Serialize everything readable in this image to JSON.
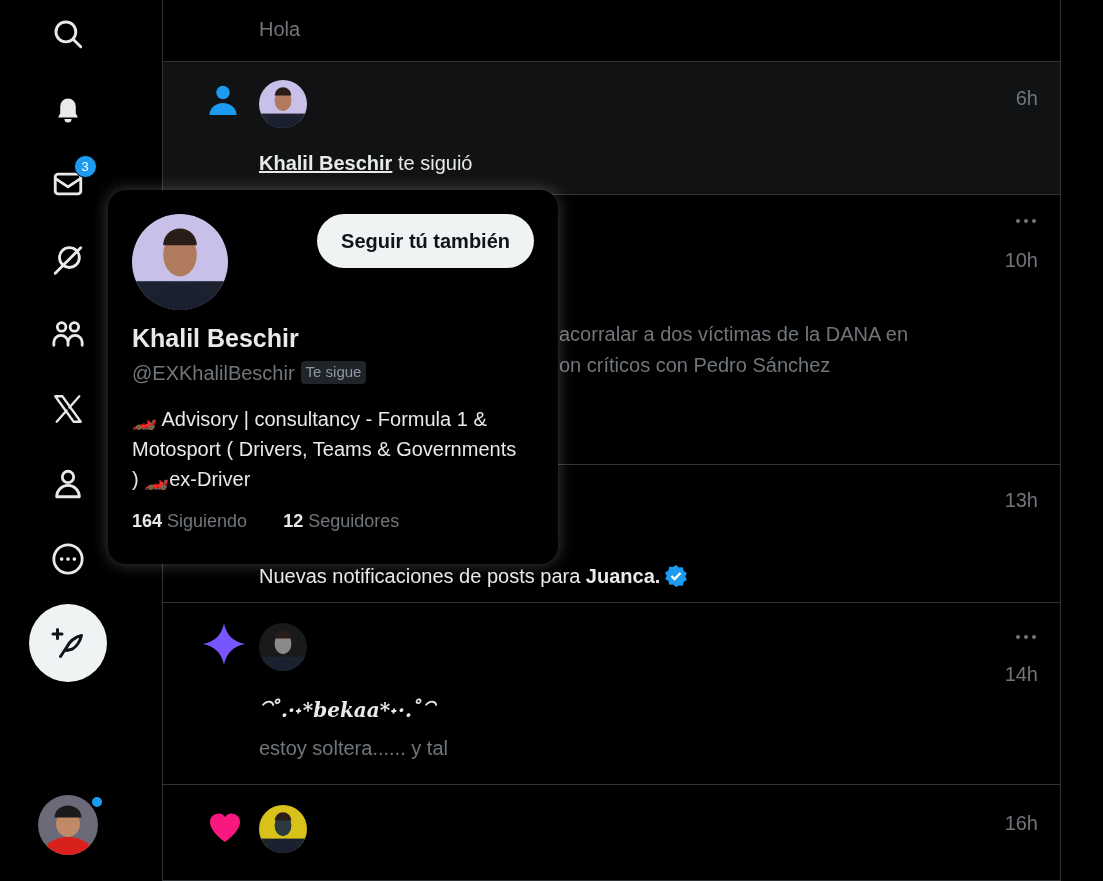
{
  "sidebar": {
    "items": [
      {
        "kind": "search"
      },
      {
        "kind": "bell"
      },
      {
        "kind": "mail",
        "badge": "3"
      },
      {
        "kind": "slash"
      },
      {
        "kind": "people"
      },
      {
        "kind": "x"
      },
      {
        "kind": "person"
      },
      {
        "kind": "more"
      }
    ],
    "compose": {
      "kind": "compose"
    },
    "account": {
      "unread": true
    }
  },
  "notifications": [
    {
      "kind": "message",
      "text": "Hola"
    },
    {
      "kind": "follow",
      "time": "6h",
      "highlighted": true,
      "name": "Khalil Beschir",
      "action": "te siguió"
    },
    {
      "kind": "post",
      "time": "10h",
      "more": true,
      "lines": [
        "acorralar a dos víctimas de la DANA en",
        "on críticos con Pedro Sánchez"
      ]
    },
    {
      "kind": "subscription",
      "time": "13h",
      "text": "Nuevas notificaciones de posts para **Juanca.**",
      "verified": true
    },
    {
      "kind": "sparkle",
      "time": "14h",
      "more": true,
      "display_name": "⁀˚.·˖*bekaa*˖·.˚⁀",
      "text": "estoy soltera...... y tal"
    },
    {
      "kind": "like",
      "time": "16h"
    }
  ],
  "hover_card": {
    "name": "Khalil Beschir",
    "handle": "@EXKhalilBeschir",
    "follows_you": "Te sigue",
    "button": "Seguir tú también",
    "bio": "🏎️ Advisory | consultancy - Formula 1 & Motosport ( Drivers, Teams & Governments ) 🏎️ex-Driver",
    "following_count": "164",
    "following_label": "Siguiendo",
    "followers_count": "12",
    "followers_label": "Seguidores"
  }
}
